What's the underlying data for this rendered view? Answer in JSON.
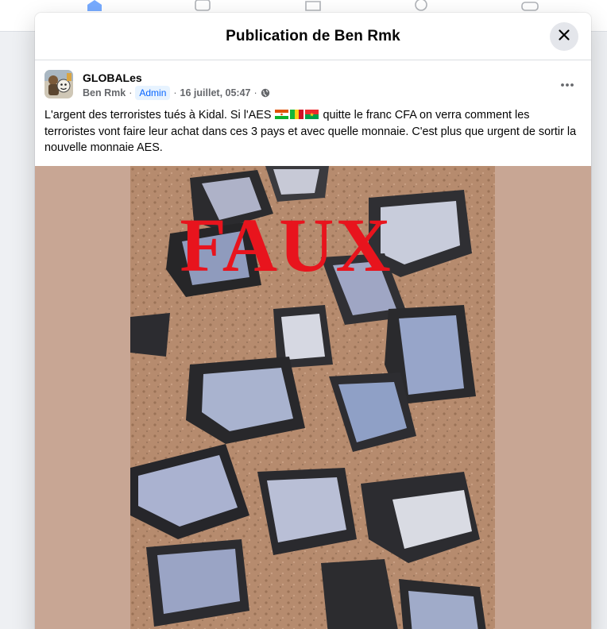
{
  "modal": {
    "title": "Publication de Ben Rmk"
  },
  "post": {
    "group_name": "GLOBALes",
    "author": "Ben Rmk",
    "separator": "·",
    "role_badge": "Admin",
    "date": "16 juillet, 05:47",
    "text_part1": "L'argent des terroristes tués à Kidal. Si  l'AES ",
    "text_part2": " quitte le franc CFA on verra comment les terroristes vont faire leur achat dans ces 3 pays et avec quelle monnaie. C'est plus que urgent de sortir la nouvelle monnaie AES.",
    "flags": [
      "niger-flag",
      "mali-flag",
      "burkina-faso-flag"
    ],
    "image_overlay_text": "FAUX"
  },
  "icons": {
    "close": "close-icon",
    "more": "more-options-icon",
    "privacy": "globe-icon",
    "nav": [
      "home-icon",
      "watch-icon",
      "marketplace-icon",
      "groups-icon",
      "gaming-icon"
    ]
  },
  "colors": {
    "stamp": "#e8141d",
    "badge_text": "#0866ff",
    "badge_bg": "#e7f3ff",
    "nav_active": "#0866ff",
    "media_bg": "#c8a694"
  }
}
